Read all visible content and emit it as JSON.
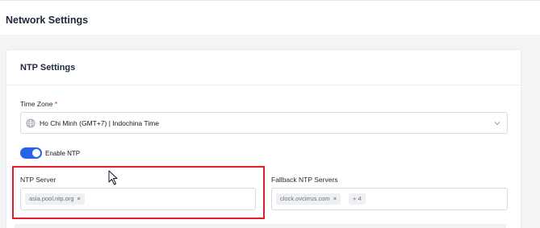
{
  "header": {
    "title": "Network Settings"
  },
  "card": {
    "title": "NTP Settings",
    "time_zone": {
      "label": "Time Zone",
      "required_mark": "*",
      "value": "Ho Chi Minh (GMT+7) | Indochina Time"
    },
    "enable_ntp": {
      "label": "Enable NTP",
      "enabled": true
    },
    "ntp_server": {
      "label": "NTP Server",
      "tags": [
        "asia.pool.ntp.org"
      ]
    },
    "fallback": {
      "label": "Fallback NTP Servers",
      "tags": [
        "clock.ovcirrus.com"
      ],
      "more": "+ 4"
    }
  },
  "icons": {
    "globe": "globe-icon",
    "chevron": "chevron-down-icon",
    "remove": "close-icon",
    "cursor": "mouse-cursor-icon"
  },
  "colors": {
    "accent": "#2563eb",
    "highlight": "#e11d2a",
    "required": "#dc2626"
  }
}
